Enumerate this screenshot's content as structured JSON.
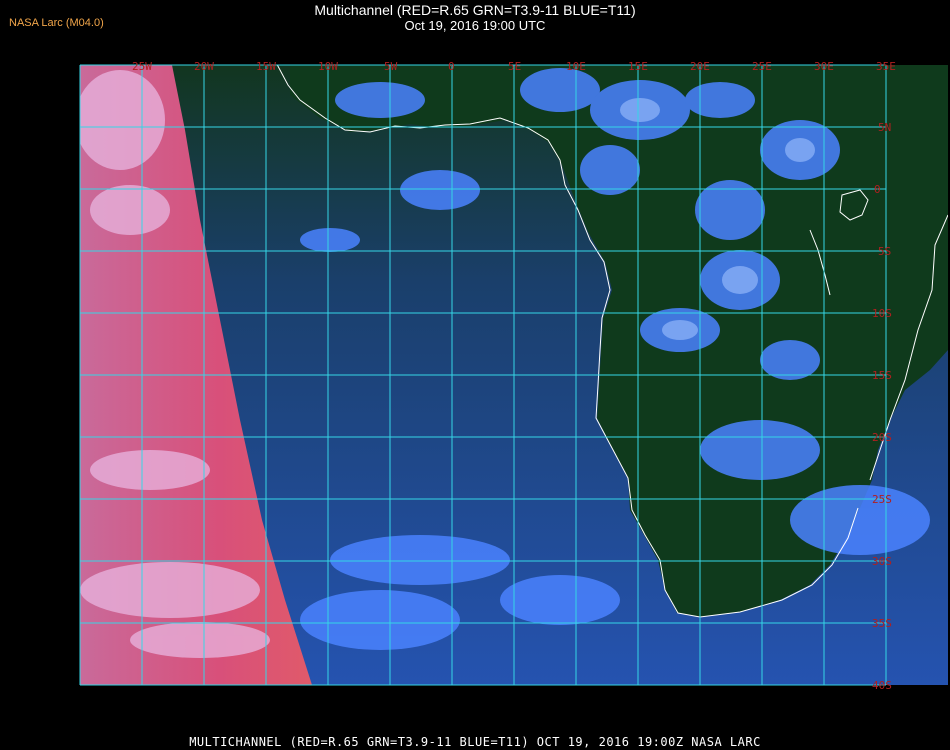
{
  "header": {
    "product_tag": "NASA Larc (M04.0)",
    "title": "Multichannel (RED=R.65 GRN=T3.9-11 BLUE=T11)",
    "subtitle": "Oct 19, 2016 19:00 UTC"
  },
  "map": {
    "longitude_labels": [
      "25W",
      "20W",
      "15W",
      "10W",
      "5W",
      "0",
      "5E",
      "10E",
      "15E",
      "20E",
      "25E",
      "30E",
      "35E"
    ],
    "latitude_labels": [
      "5N",
      "0",
      "5S",
      "10S",
      "15S",
      "20S",
      "25S",
      "30S",
      "35S",
      "40S"
    ],
    "colors": {
      "grid": "#35d6e6",
      "grid_label": "#b02020",
      "coastline": "#ffffff",
      "ocean": "#1f3f7f",
      "land": "#0f3a1c",
      "cloud": "#4a82ff",
      "dayside": "#d8507a"
    }
  },
  "footer": {
    "caption": "MULTICHANNEL (RED=R.65 GRN=T3.9-11 BLUE=T11) OCT 19, 2016 19:00Z  NASA LARC"
  }
}
